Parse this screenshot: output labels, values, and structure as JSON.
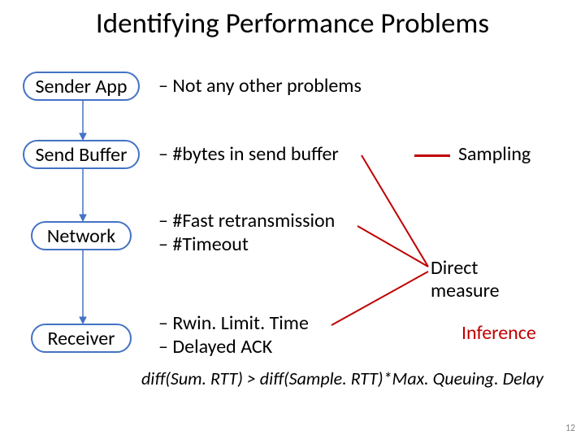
{
  "title": "Identifying Performance Problems",
  "boxes": {
    "sender_app": "Sender App",
    "send_buffer": "Send Buffer",
    "network": "Network",
    "receiver": "Receiver"
  },
  "descs": {
    "sender_app": "– Not any other problems",
    "send_buffer": "– #bytes in send buffer",
    "network_l1": "– #Fast retransmission",
    "network_l2": "– #Timeout",
    "receiver_l1": "– Rwin. Limit. Time",
    "receiver_l2": "– Delayed ACK"
  },
  "labels": {
    "sampling": "Sampling",
    "direct_l1": "Direct",
    "direct_l2": "measure",
    "inference": "Inference"
  },
  "formula": "diff(Sum. RTT) > diff(Sample. RTT)*Max. Queuing. Delay",
  "page": "12"
}
